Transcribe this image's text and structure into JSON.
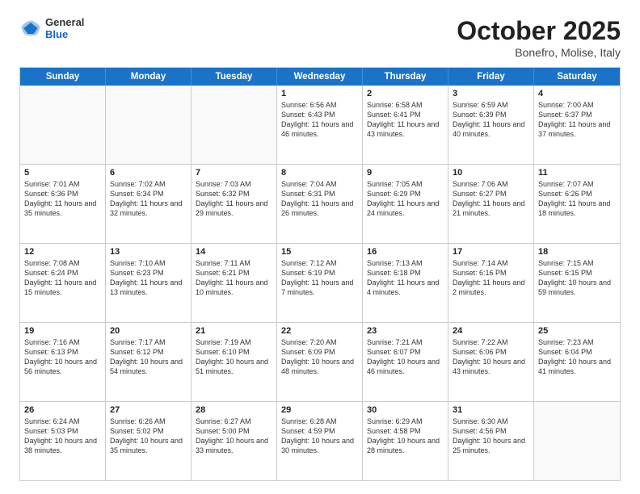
{
  "header": {
    "logo": {
      "general": "General",
      "blue": "Blue"
    },
    "title": "October 2025",
    "subtitle": "Bonefro, Molise, Italy"
  },
  "dayHeaders": [
    "Sunday",
    "Monday",
    "Tuesday",
    "Wednesday",
    "Thursday",
    "Friday",
    "Saturday"
  ],
  "weeks": [
    [
      {
        "num": "",
        "info": ""
      },
      {
        "num": "",
        "info": ""
      },
      {
        "num": "",
        "info": ""
      },
      {
        "num": "1",
        "info": "Sunrise: 6:56 AM\nSunset: 6:43 PM\nDaylight: 11 hours and 46 minutes."
      },
      {
        "num": "2",
        "info": "Sunrise: 6:58 AM\nSunset: 6:41 PM\nDaylight: 11 hours and 43 minutes."
      },
      {
        "num": "3",
        "info": "Sunrise: 6:59 AM\nSunset: 6:39 PM\nDaylight: 11 hours and 40 minutes."
      },
      {
        "num": "4",
        "info": "Sunrise: 7:00 AM\nSunset: 6:37 PM\nDaylight: 11 hours and 37 minutes."
      }
    ],
    [
      {
        "num": "5",
        "info": "Sunrise: 7:01 AM\nSunset: 6:36 PM\nDaylight: 11 hours and 35 minutes."
      },
      {
        "num": "6",
        "info": "Sunrise: 7:02 AM\nSunset: 6:34 PM\nDaylight: 11 hours and 32 minutes."
      },
      {
        "num": "7",
        "info": "Sunrise: 7:03 AM\nSunset: 6:32 PM\nDaylight: 11 hours and 29 minutes."
      },
      {
        "num": "8",
        "info": "Sunrise: 7:04 AM\nSunset: 6:31 PM\nDaylight: 11 hours and 26 minutes."
      },
      {
        "num": "9",
        "info": "Sunrise: 7:05 AM\nSunset: 6:29 PM\nDaylight: 11 hours and 24 minutes."
      },
      {
        "num": "10",
        "info": "Sunrise: 7:06 AM\nSunset: 6:27 PM\nDaylight: 11 hours and 21 minutes."
      },
      {
        "num": "11",
        "info": "Sunrise: 7:07 AM\nSunset: 6:26 PM\nDaylight: 11 hours and 18 minutes."
      }
    ],
    [
      {
        "num": "12",
        "info": "Sunrise: 7:08 AM\nSunset: 6:24 PM\nDaylight: 11 hours and 15 minutes."
      },
      {
        "num": "13",
        "info": "Sunrise: 7:10 AM\nSunset: 6:23 PM\nDaylight: 11 hours and 13 minutes."
      },
      {
        "num": "14",
        "info": "Sunrise: 7:11 AM\nSunset: 6:21 PM\nDaylight: 11 hours and 10 minutes."
      },
      {
        "num": "15",
        "info": "Sunrise: 7:12 AM\nSunset: 6:19 PM\nDaylight: 11 hours and 7 minutes."
      },
      {
        "num": "16",
        "info": "Sunrise: 7:13 AM\nSunset: 6:18 PM\nDaylight: 11 hours and 4 minutes."
      },
      {
        "num": "17",
        "info": "Sunrise: 7:14 AM\nSunset: 6:16 PM\nDaylight: 11 hours and 2 minutes."
      },
      {
        "num": "18",
        "info": "Sunrise: 7:15 AM\nSunset: 6:15 PM\nDaylight: 10 hours and 59 minutes."
      }
    ],
    [
      {
        "num": "19",
        "info": "Sunrise: 7:16 AM\nSunset: 6:13 PM\nDaylight: 10 hours and 56 minutes."
      },
      {
        "num": "20",
        "info": "Sunrise: 7:17 AM\nSunset: 6:12 PM\nDaylight: 10 hours and 54 minutes."
      },
      {
        "num": "21",
        "info": "Sunrise: 7:19 AM\nSunset: 6:10 PM\nDaylight: 10 hours and 51 minutes."
      },
      {
        "num": "22",
        "info": "Sunrise: 7:20 AM\nSunset: 6:09 PM\nDaylight: 10 hours and 48 minutes."
      },
      {
        "num": "23",
        "info": "Sunrise: 7:21 AM\nSunset: 6:07 PM\nDaylight: 10 hours and 46 minutes."
      },
      {
        "num": "24",
        "info": "Sunrise: 7:22 AM\nSunset: 6:06 PM\nDaylight: 10 hours and 43 minutes."
      },
      {
        "num": "25",
        "info": "Sunrise: 7:23 AM\nSunset: 6:04 PM\nDaylight: 10 hours and 41 minutes."
      }
    ],
    [
      {
        "num": "26",
        "info": "Sunrise: 6:24 AM\nSunset: 5:03 PM\nDaylight: 10 hours and 38 minutes."
      },
      {
        "num": "27",
        "info": "Sunrise: 6:26 AM\nSunset: 5:02 PM\nDaylight: 10 hours and 35 minutes."
      },
      {
        "num": "28",
        "info": "Sunrise: 6:27 AM\nSunset: 5:00 PM\nDaylight: 10 hours and 33 minutes."
      },
      {
        "num": "29",
        "info": "Sunrise: 6:28 AM\nSunset: 4:59 PM\nDaylight: 10 hours and 30 minutes."
      },
      {
        "num": "30",
        "info": "Sunrise: 6:29 AM\nSunset: 4:58 PM\nDaylight: 10 hours and 28 minutes."
      },
      {
        "num": "31",
        "info": "Sunrise: 6:30 AM\nSunset: 4:56 PM\nDaylight: 10 hours and 25 minutes."
      },
      {
        "num": "",
        "info": ""
      }
    ]
  ]
}
